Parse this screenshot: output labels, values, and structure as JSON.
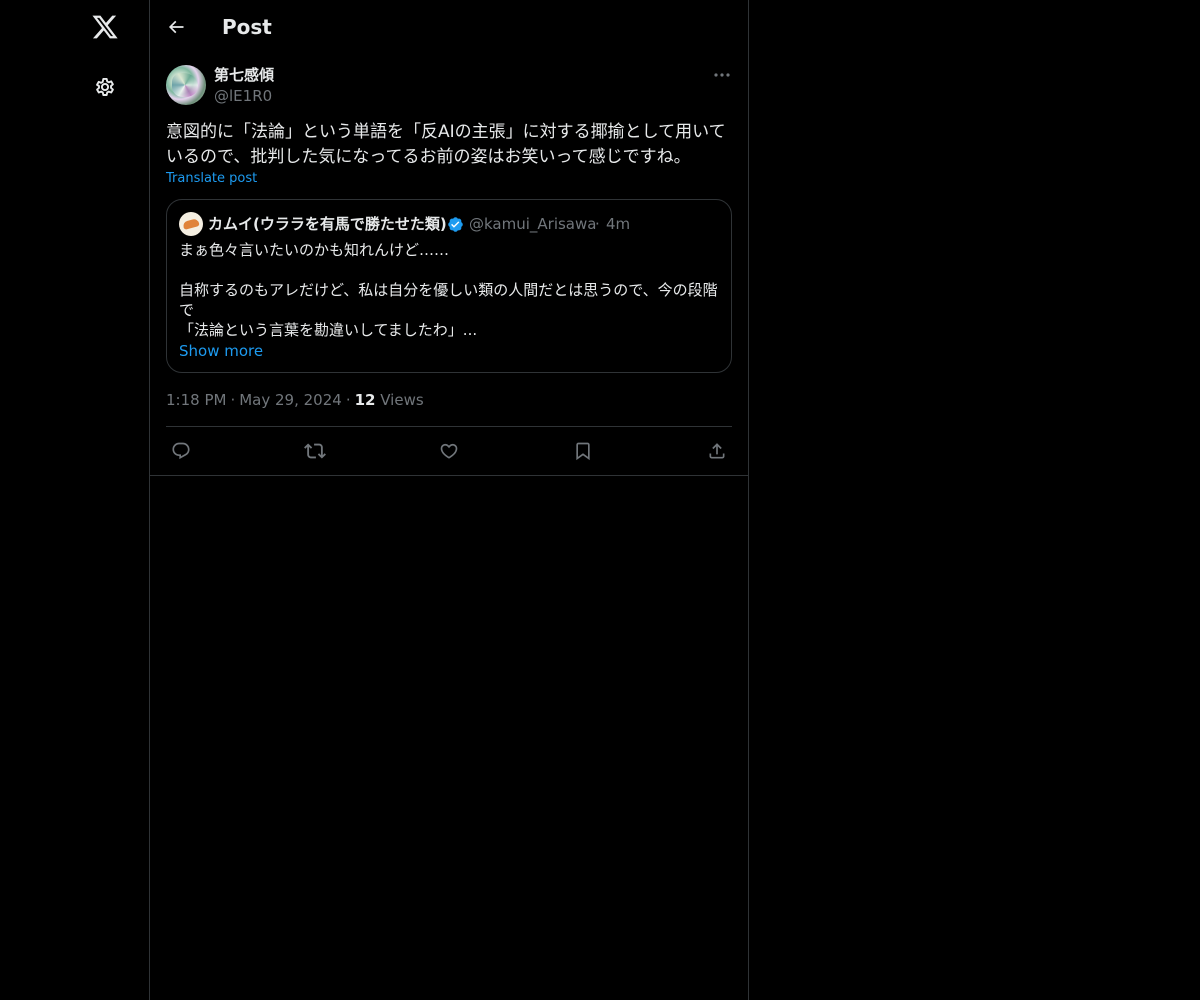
{
  "nav": {
    "logo_icon": "x-logo-icon",
    "settings_icon": "gear-icon"
  },
  "header": {
    "back_icon": "arrow-left-icon",
    "title": "Post"
  },
  "post": {
    "author_name": "第七感傾",
    "author_handle": "@lE1R0",
    "text_line1": "意図的に「法論」という単語を「反AIの主張」に対する揶揄として用いて",
    "text_line2": "いるので、批判した気になってるお前の姿はお笑いって感じですね。",
    "translate_label": "Translate post",
    "timestamp": "1:18 PM",
    "date": "May 29, 2024",
    "separator": "·",
    "views_count": "12",
    "views_label": "Views"
  },
  "quote": {
    "name": "カムイ(ウララを有馬で勝たせた類)",
    "handle": "@kamui_Arisawa",
    "separator": "·",
    "time": "4m",
    "line1": "まぁ色々言いたいのかも知れんけど……",
    "line2": "自称するのもアレだけど、私は自分を優しい類の人間だとは思うので、今の段階",
    "line3": "で",
    "line4": "「法論という言葉を勘違いしてましたわ」...",
    "show_more": "Show more",
    "verified_color": "#1d9bf0"
  },
  "actions": {
    "reply_icon": "reply-icon",
    "repost_icon": "repost-icon",
    "like_icon": "heart-icon",
    "bookmark_icon": "bookmark-icon",
    "share_icon": "share-icon"
  },
  "colors": {
    "background": "#000000",
    "text": "#e7e9ea",
    "muted": "#71767b",
    "accent": "#1d9bf0",
    "border": "#2f3336"
  }
}
